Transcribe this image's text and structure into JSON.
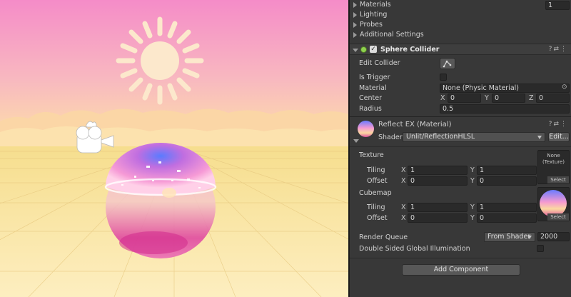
{
  "inspector": {
    "renderer_sections": [
      {
        "label": "Materials",
        "value": "1"
      },
      {
        "label": "Lighting"
      },
      {
        "label": "Probes"
      },
      {
        "label": "Additional Settings"
      }
    ],
    "sphere_collider": {
      "title": "Sphere Collider",
      "edit_collider_label": "Edit Collider",
      "is_trigger_label": "Is Trigger",
      "is_trigger": false,
      "material_label": "Material",
      "material_value": "None (Physic Material)",
      "center_label": "Center",
      "center": {
        "x_label": "X",
        "x": "0",
        "y_label": "Y",
        "y": "0",
        "z_label": "Z",
        "z": "0"
      },
      "radius_label": "Radius",
      "radius": "0.5"
    },
    "material": {
      "title": "Reflect EX (Material)",
      "shader_label": "Shader",
      "shader_value": "Unlit/ReflectionHLSL",
      "edit_button": "Edit...",
      "texture": {
        "label": "Texture",
        "slot_text": "None\n(Texture)",
        "select": "Select",
        "tiling_label": "Tiling",
        "tiling_x": "1",
        "tiling_y": "1",
        "offset_label": "Offset",
        "offset_x": "0",
        "offset_y": "0"
      },
      "cubemap": {
        "label": "Cubemap",
        "select": "Select",
        "tiling_label": "Tiling",
        "tiling_x": "1",
        "tiling_y": "1",
        "offset_label": "Offset",
        "offset_x": "0",
        "offset_y": "0"
      },
      "x_label": "X",
      "y_label": "Y",
      "render_queue_label": "Render Queue",
      "render_queue_mode": "From Shader",
      "render_queue_value": "2000",
      "double_sided_gi_label": "Double Sided Global Illumination",
      "double_sided_gi": false
    },
    "add_component": "Add Component"
  },
  "colors": {
    "sky_top": "#f58cc8",
    "sky_horizon": "#fde0a8",
    "ground": "#fbe7a6",
    "inspector_bg": "#383838"
  },
  "icons": {
    "sun": "sun-icon",
    "camera": "camera-gizmo-icon",
    "collider_toggle": "collider-component-icon",
    "material": "material-preview-icon"
  }
}
